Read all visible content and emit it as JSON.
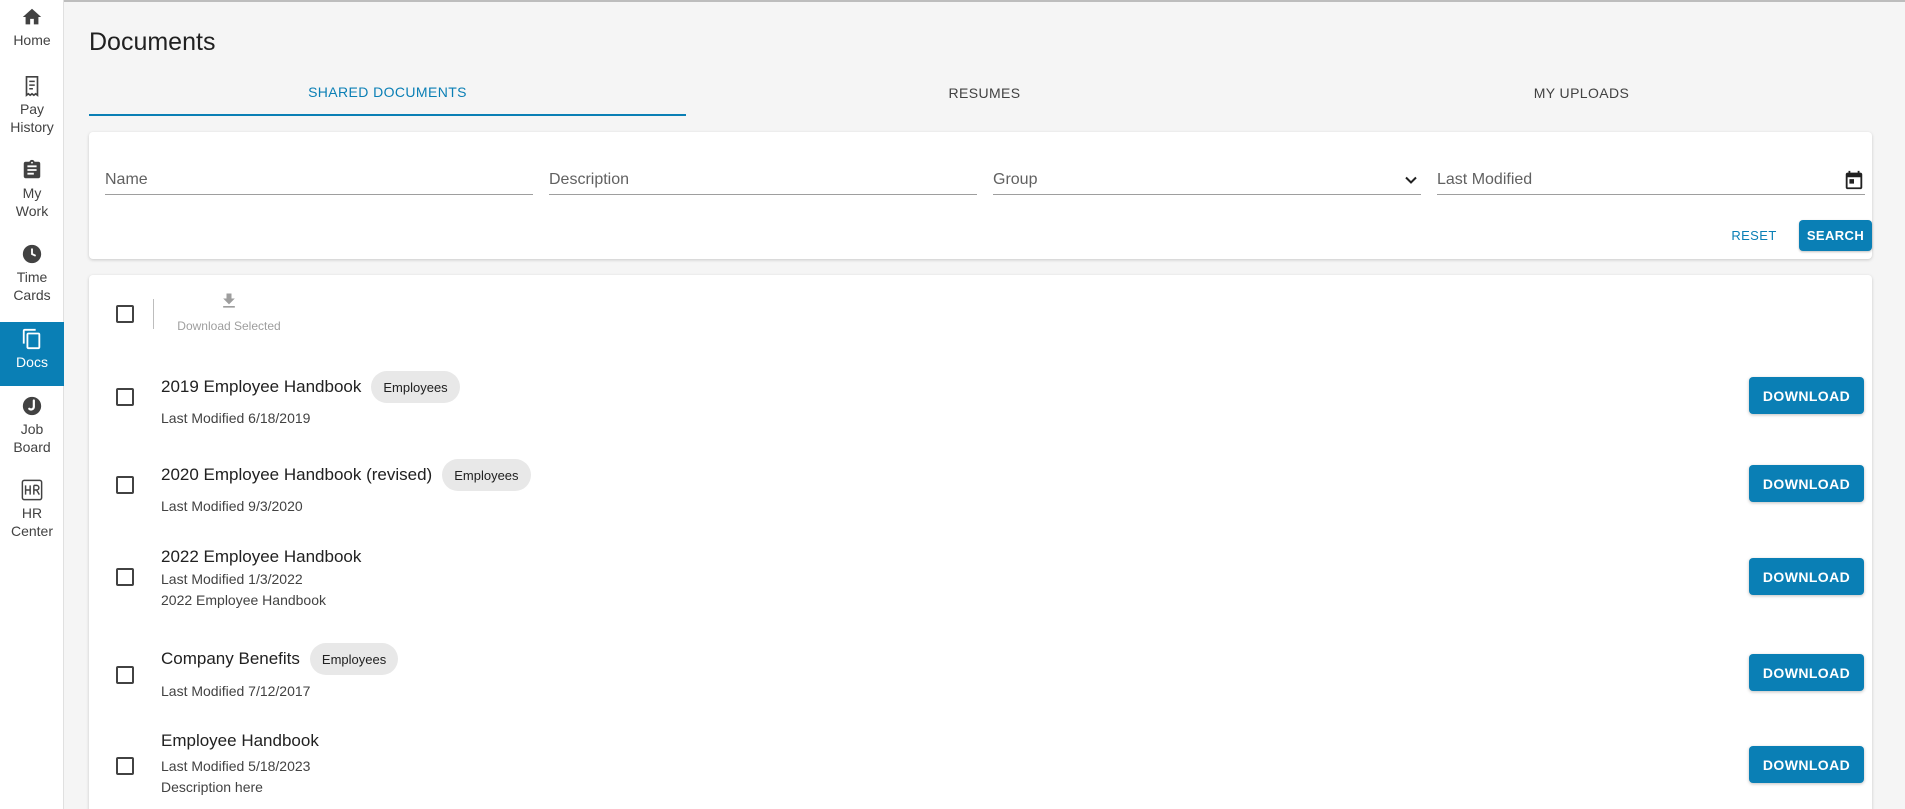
{
  "sidebar": {
    "items": [
      {
        "label_lines": [
          "Home"
        ],
        "icon": "home-icon",
        "active": false
      },
      {
        "label_lines": [
          "Pay",
          "History"
        ],
        "icon": "receipt-icon",
        "active": false
      },
      {
        "label_lines": [
          "My",
          "Work"
        ],
        "icon": "clipboard-icon",
        "active": false
      },
      {
        "label_lines": [
          "Time",
          "Cards"
        ],
        "icon": "clock-icon",
        "active": false
      },
      {
        "label_lines": [
          "Docs"
        ],
        "icon": "documents-icon",
        "active": true
      },
      {
        "label_lines": [
          "Job",
          "Board"
        ],
        "icon": "job-board-icon",
        "active": false
      },
      {
        "label_lines": [
          "HR",
          "Center"
        ],
        "icon": "hr-icon",
        "active": false
      }
    ]
  },
  "page": {
    "title": "Documents"
  },
  "tabs": [
    {
      "label": "SHARED DOCUMENTS",
      "active": true
    },
    {
      "label": "RESUMES",
      "active": false
    },
    {
      "label": "MY UPLOADS",
      "active": false
    }
  ],
  "filters": {
    "name_placeholder": "Name",
    "description_placeholder": "Description",
    "group_placeholder": "Group",
    "last_modified_placeholder": "Last Modified",
    "reset_label": "RESET",
    "search_label": "SEARCH"
  },
  "list": {
    "download_selected_label": "Download Selected",
    "download_label": "DOWNLOAD",
    "documents": [
      {
        "title": "2019 Employee Handbook",
        "chip": "Employees",
        "modified": "Last Modified 6/18/2019",
        "description": ""
      },
      {
        "title": "2020 Employee Handbook (revised)",
        "chip": "Employees",
        "modified": "Last Modified 9/3/2020",
        "description": ""
      },
      {
        "title": "2022 Employee Handbook",
        "chip": "",
        "modified": "Last Modified 1/3/2022",
        "description": "2022 Employee Handbook"
      },
      {
        "title": "Company Benefits",
        "chip": "Employees",
        "modified": "Last Modified 7/12/2017",
        "description": ""
      },
      {
        "title": "Employee Handbook",
        "chip": "",
        "modified": "Last Modified 5/18/2023",
        "description": "Description here"
      }
    ]
  },
  "colors": {
    "accent": "#0a7fb5",
    "chip_bg": "#e8e8e8",
    "background": "#f5f5f5"
  }
}
